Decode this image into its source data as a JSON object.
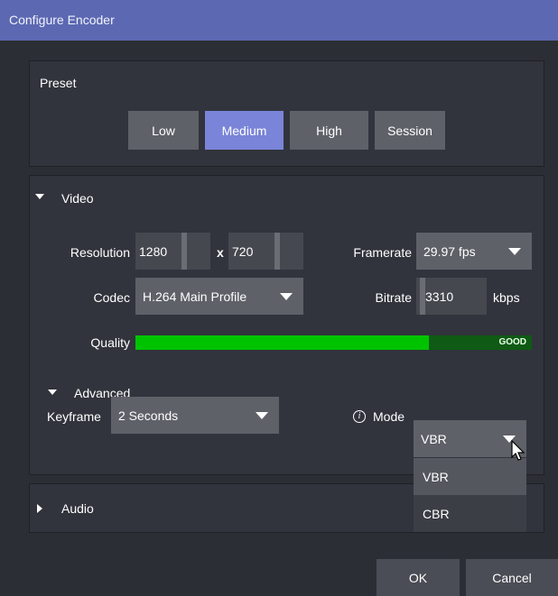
{
  "window": {
    "title": "Configure Encoder"
  },
  "preset": {
    "label": "Preset",
    "buttons": [
      "Low",
      "Medium",
      "High",
      "Session"
    ],
    "selected": "Medium"
  },
  "video": {
    "label": "Video",
    "resolution_label": "Resolution",
    "width": "1280",
    "x_label": "x",
    "height": "720",
    "framerate_label": "Framerate",
    "framerate_value": "29.97 fps",
    "codec_label": "Codec",
    "codec_value": "H.264 Main Profile",
    "bitrate_label": "Bitrate",
    "bitrate_value": "3310",
    "bitrate_unit": "kbps",
    "quality_label": "Quality",
    "quality_text": "GOOD",
    "quality_level": 0.74
  },
  "advanced": {
    "label": "Advanced",
    "keyframe_label": "Keyframe",
    "keyframe_value": "2 Seconds",
    "mode_label": "Mode",
    "mode_value": "VBR",
    "mode_options": [
      "VBR",
      "CBR"
    ]
  },
  "audio": {
    "label": "Audio"
  },
  "footer": {
    "ok_label": "OK",
    "cancel_label": "Cancel"
  },
  "colors": {
    "titlebar": "#5c68b2",
    "accent_button": "#7a84d8",
    "quality_fill": "#00c300",
    "background": "#2b2e35"
  }
}
